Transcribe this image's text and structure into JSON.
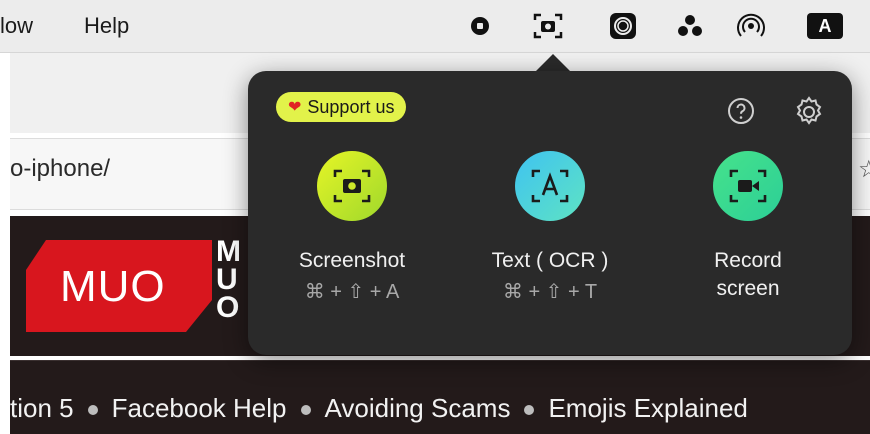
{
  "menubar": {
    "items": [
      "low",
      "Help"
    ],
    "tray_icons": [
      "stop-record-icon",
      "screenshot-app-icon",
      "camera-lens-icon",
      "three-dots-cluster-icon",
      "airdrop-icon",
      "input-source-icon"
    ],
    "input_source_label": "A"
  },
  "browser": {
    "address_text": "o-iphone/",
    "star_partial": "☆",
    "logo_text": "MUO",
    "logo_side_letters": [
      "M",
      "U",
      "O"
    ],
    "ticker_items": [
      "tion 5",
      "Facebook Help",
      "Avoiding Scams",
      "Emojis Explained"
    ]
  },
  "popover": {
    "support_label": "Support us",
    "actions": [
      {
        "label": "Screenshot",
        "shortcut": "⌘ + ⇧ + A"
      },
      {
        "label": "Text ( OCR )",
        "shortcut": "⌘ + ⇧ + T"
      },
      {
        "label": "Record screen",
        "shortcut": ""
      }
    ]
  },
  "colors": {
    "popover_bg": "#2a2a2a",
    "support_badge": "#e2f24a",
    "screenshot_gradient": [
      "#e6f526",
      "#9fd82c"
    ],
    "ocr_gradient": [
      "#3fc3f1",
      "#5ee3c3"
    ],
    "record_gradient": [
      "#46e28b",
      "#2ccf97"
    ],
    "brand_red": "#d8161e"
  }
}
